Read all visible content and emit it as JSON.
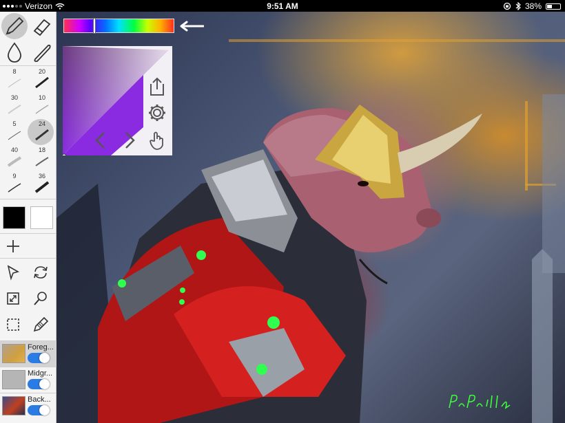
{
  "status_bar": {
    "carrier": "Verizon",
    "time": "9:51 AM",
    "battery": "38%"
  },
  "brush_sizes": [
    "8",
    "20",
    "30",
    "10",
    "5",
    "24",
    "40",
    "18",
    "9",
    "36"
  ],
  "colors": {
    "primary_swatch": "#000000",
    "secondary_swatch": "#ffffff",
    "current_hue": "#8a2be2",
    "toggle_accent": "#2a7be4"
  },
  "hue_position": 0.27,
  "layers": [
    {
      "name": "Foreg...",
      "visible": true,
      "selected": true
    },
    {
      "name": "Midgr...",
      "visible": true,
      "selected": false
    },
    {
      "name": "Back...",
      "visible": true,
      "selected": false
    }
  ],
  "icons": {
    "pencil": "pencil-icon",
    "eraser": "eraser-icon",
    "dropper": "smudge-drop-icon",
    "line": "line-tool-icon",
    "add": "add-icon",
    "select_arrow": "select-arrow-icon",
    "rotate": "rotate-icon",
    "fit_screen": "fit-screen-icon",
    "magnifier": "magnifier-icon",
    "marquee": "marquee-selection-icon",
    "pen_edit": "pen-edit-icon",
    "share": "share-icon",
    "settings": "gear-icon",
    "undo": "undo-chevron-icon",
    "redo": "redo-chevron-icon",
    "touch": "touch-icon"
  },
  "signature": "PapaPoliani"
}
